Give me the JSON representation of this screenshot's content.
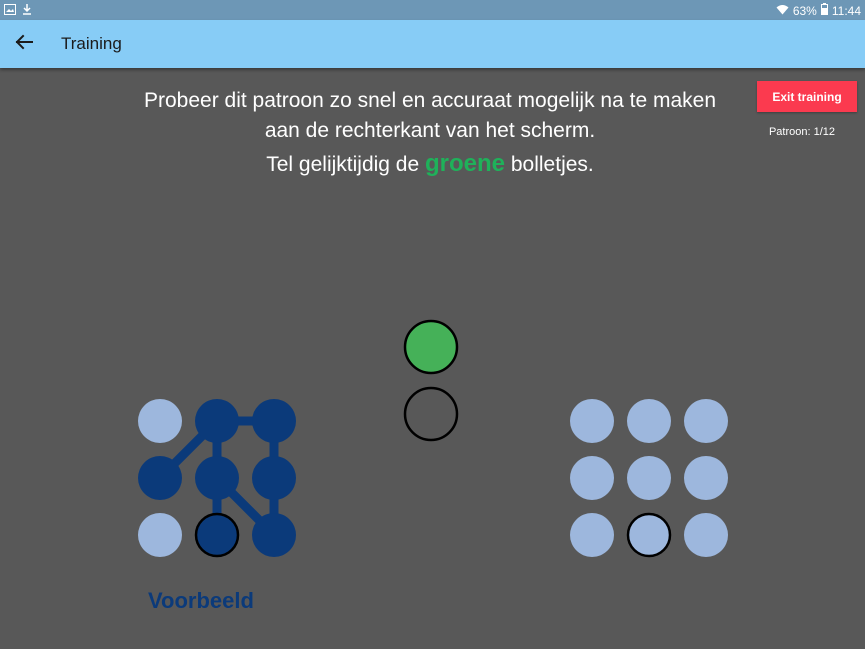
{
  "status_bar": {
    "battery": "63%",
    "time": "11:44",
    "icons": [
      "image-icon",
      "download-icon",
      "wifi-icon",
      "battery-icon"
    ]
  },
  "app_bar": {
    "title": "Training",
    "back_icon": "arrow-left-icon"
  },
  "instruction": {
    "line1": "Probeer dit patroon zo snel en accuraat mogelijk na te maken",
    "line2": "aan de rechterkant van het scherm.",
    "line3_prefix": "Tel gelijktijdig de ",
    "line3_highlight": "groene",
    "line3_suffix": " bolletjes."
  },
  "exit_button": "Exit training",
  "counter": "Patroon: 1/12",
  "example_label": "Voorbeeld",
  "colors": {
    "background": "#585858",
    "app_bar": "#87ccf6",
    "status_bar": "#6d97b6",
    "exit_button": "#fb3a4f",
    "highlight_green": "#1fb15a",
    "active_dot": "#0b3a7a",
    "inactive_dot": "#9db7dd",
    "stimulus_green": "#45b158"
  },
  "example_grid": {
    "active": [
      [
        0,
        1
      ],
      [
        0,
        2
      ],
      [
        1,
        0
      ],
      [
        1,
        1
      ],
      [
        1,
        2
      ],
      [
        2,
        1
      ],
      [
        2,
        2
      ]
    ],
    "outlined": [
      [
        2,
        1
      ]
    ],
    "connections": [
      [
        [
          1,
          0
        ],
        [
          0,
          1
        ]
      ],
      [
        [
          0,
          1
        ],
        [
          0,
          2
        ]
      ],
      [
        [
          0,
          1
        ],
        [
          1,
          1
        ]
      ],
      [
        [
          0,
          2
        ],
        [
          1,
          2
        ]
      ],
      [
        [
          1,
          1
        ],
        [
          2,
          1
        ]
      ],
      [
        [
          1,
          1
        ],
        [
          2,
          2
        ]
      ],
      [
        [
          1,
          2
        ],
        [
          2,
          2
        ]
      ]
    ]
  },
  "input_grid": {
    "active": [],
    "outlined": [
      [
        2,
        1
      ]
    ]
  },
  "stimulus": [
    {
      "fill": "green"
    },
    {
      "fill": "empty"
    }
  ]
}
